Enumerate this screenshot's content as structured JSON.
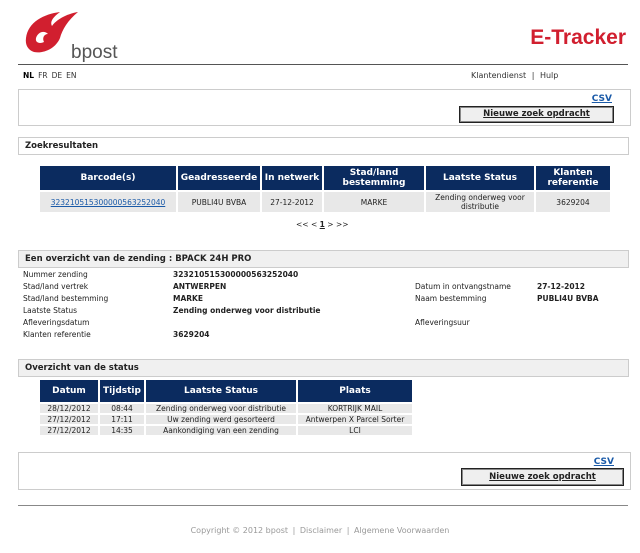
{
  "header": {
    "logo_text": "bpost",
    "app_title": "E-Tracker"
  },
  "languages": [
    "NL",
    "FR",
    "DE",
    "EN"
  ],
  "active_language": "NL",
  "top_links": {
    "service": "Klantendienst",
    "separator": "|",
    "help": "Hulp"
  },
  "toolbar": {
    "csv_label": "CSV",
    "new_search_label": "Nieuwe zoek opdracht"
  },
  "results": {
    "title": "Zoekresultaten",
    "columns": [
      "Barcode(s)",
      "Geadresseerde",
      "In netwerk",
      "Stad/land bestemming",
      "Laatste Status",
      "Klanten referentie"
    ],
    "rows": [
      [
        "323210515300000563252040",
        "PUBLI4U BVBA",
        "27-12-2012",
        "MARKE",
        "Zending onderweg voor distributie",
        "3629204"
      ]
    ],
    "pager": {
      "first": "<<",
      "prev": "<",
      "current": "1",
      "next": ">",
      "last": ">>"
    }
  },
  "overview": {
    "title": "Een overzicht van de zending : BPACK 24H PRO",
    "left": [
      {
        "label": "Nummer zending",
        "value": "323210515300000563252040"
      },
      {
        "label": "Stad/land vertrek",
        "value": "ANTWERPEN"
      },
      {
        "label": "Stad/land bestemming",
        "value": "MARKE"
      },
      {
        "label": "Laatste Status",
        "value": "Zending onderweg voor distributie"
      },
      {
        "label": "Afleveringsdatum",
        "value": ""
      },
      {
        "label": "Klanten referentie",
        "value": "3629204"
      }
    ],
    "right": [
      {
        "label": "Datum in ontvangstname",
        "value": "27-12-2012"
      },
      {
        "label": "Naam bestemming",
        "value": "PUBLI4U BVBA"
      },
      {
        "label": "Afleveringsuur",
        "value": ""
      }
    ]
  },
  "status": {
    "title": "Overzicht van de status",
    "columns": [
      "Datum",
      "Tijdstip",
      "Laatste Status",
      "Plaats"
    ],
    "rows": [
      [
        "28/12/2012",
        "08:44",
        "Zending onderweg voor distributie",
        "KORTRIJK MAIL"
      ],
      [
        "27/12/2012",
        "17:11",
        "Uw zending werd gesorteerd",
        "Antwerpen X Parcel Sorter"
      ],
      [
        "27/12/2012",
        "14:35",
        "Aankondiging van een zending",
        "LCI"
      ]
    ]
  },
  "footer": {
    "copyright": "Copyright © 2012 bpost",
    "sep": "|",
    "disclaimer": "Disclaimer",
    "terms": "Algemene Voorwaarden"
  },
  "colors": {
    "brand_red": "#d11f2f",
    "table_header": "#0b2b5f",
    "link": "#1a5aa8"
  }
}
